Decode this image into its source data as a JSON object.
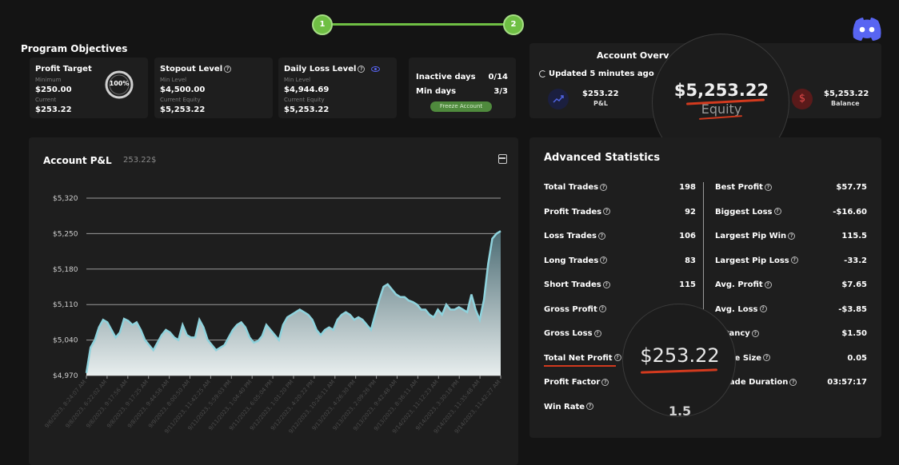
{
  "stepper": {
    "step1": "1",
    "step2": "2"
  },
  "objectives": {
    "title": "Program Objectives",
    "profit_target": {
      "label": "Profit Target",
      "min_label": "Minimum",
      "min_value": "$250.00",
      "cur_label": "Current",
      "cur_value": "$253.22",
      "ring_text": "100%",
      "progress_percent": 100
    },
    "stopout": {
      "label": "Stopout Level",
      "min_label": "Min Level",
      "min_value": "$4,500.00",
      "cur_label": "Current Equity",
      "cur_value": "$5,253.22"
    },
    "daily_loss": {
      "label": "Daily Loss Level",
      "min_label": "Min Level",
      "min_value": "$4,944.69",
      "cur_label": "Current Equity",
      "cur_value": "$5,253.22"
    },
    "days": {
      "inactive_label": "Inactive days",
      "inactive_value": "0/14",
      "min_label": "Min days",
      "min_value": "3/3",
      "freeze_label": "Freeze Account"
    }
  },
  "overview": {
    "title": "Account Overv",
    "updated": "Updated 5 minutes ago",
    "pnl_value": "$253.22",
    "pnl_label": "P&L",
    "equity_value": "$5,253.22",
    "equity_label": "Equity",
    "balance_value": "$5,253.22",
    "balance_label": "Balance",
    "balance_icon": "$"
  },
  "pnl_chart": {
    "title": "Account P&L",
    "amount": "253.22$",
    "icon": "calendar-icon"
  },
  "chart_data": {
    "type": "area",
    "yticks": [
      "$5,320",
      "$5,250",
      "$5,180",
      "$5,110",
      "$5,040",
      "$4,970"
    ],
    "ylim": [
      4970,
      5320
    ],
    "values": [
      4975,
      5025,
      5040,
      5065,
      5080,
      5075,
      5060,
      5045,
      5055,
      5082,
      5078,
      5070,
      5075,
      5060,
      5040,
      5030,
      5020,
      5035,
      5050,
      5060,
      5055,
      5045,
      5040,
      5070,
      5050,
      5045,
      5045,
      5080,
      5065,
      5040,
      5030,
      5020,
      5025,
      5030,
      5045,
      5060,
      5070,
      5075,
      5065,
      5045,
      5035,
      5038,
      5048,
      5070,
      5060,
      5050,
      5040,
      5070,
      5085,
      5090,
      5095,
      5100,
      5095,
      5090,
      5080,
      5060,
      5050,
      5060,
      5065,
      5060,
      5080,
      5090,
      5095,
      5090,
      5080,
      5085,
      5080,
      5070,
      5060,
      5090,
      5120,
      5145,
      5150,
      5140,
      5130,
      5125,
      5125,
      5118,
      5115,
      5110,
      5100,
      5100,
      5090,
      5085,
      5100,
      5090,
      5110,
      5100,
      5100,
      5105,
      5100,
      5095,
      5130,
      5100,
      5080,
      5120,
      5190,
      5240,
      5250,
      5255
    ],
    "xticks": [
      "9/6/2023, 8:24:07 AM",
      "9/8/2023, 6:22:02 AM",
      "9/8/2023, 9:17:56 AM",
      "9/8/2023, 9:17:25 AM",
      "9/8/2023, 9:44:58 AM",
      "9/9/2023, 8:00:50 AM",
      "9/11/2023, 11:42:25 AM",
      "9/11/2023, 5:59:03 PM",
      "9/11/2023, 1:04:40 PM",
      "9/11/2023, 6:05:04 PM",
      "9/12/2023, 1:01:20 PM",
      "9/12/2023, 4:20:22 PM",
      "9/12/2023, 10:26:11 AM",
      "9/13/2023, 4:26:30 PM",
      "9/13/2023, 2:09:26 PM",
      "9/13/2023, 9:42:48 AM",
      "9/13/2023, 8:36:11 AM",
      "9/14/2023, 11:12:23 AM",
      "9/14/2023, 3:30:18 PM",
      "9/14/2023, 11:35:48 AM",
      "9/14/2023, 11:42:27 AM"
    ]
  },
  "advanced": {
    "title": "Advanced Statistics",
    "left": [
      {
        "label": "Total Trades",
        "value": "198"
      },
      {
        "label": "Profit Trades",
        "value": "92"
      },
      {
        "label": "Loss Trades",
        "value": "106"
      },
      {
        "label": "Long Trades",
        "value": "83"
      },
      {
        "label": "Short Trades",
        "value": "115"
      },
      {
        "label": "Gross Profit",
        "value": ""
      },
      {
        "label": "Gross Loss",
        "value": ""
      },
      {
        "label": "Total Net Profit",
        "value": ""
      },
      {
        "label": "Profit Factor",
        "value": ""
      },
      {
        "label": "Win Rate",
        "value": ""
      }
    ],
    "right": [
      {
        "label": "Best Profit",
        "value": "$57.75"
      },
      {
        "label": "Biggest Loss",
        "value": "-$16.60"
      },
      {
        "label": "Largest Pip Win",
        "value": "115.5"
      },
      {
        "label": "Largest Pip Loss",
        "value": "-33.2"
      },
      {
        "label": "Avg. Profit",
        "value": "$7.65"
      },
      {
        "label": "Avg. Loss",
        "value": "-$3.85"
      },
      {
        "label": "ectancy",
        "value": "$1.50"
      },
      {
        "label": "Trade Size",
        "value": "0.05"
      },
      {
        "label": ". Trade Duration",
        "value": "03:57:17"
      }
    ],
    "zoom_value": "$253.22",
    "zoom_partial": "1.5"
  },
  "colors": {
    "accent_green": "#6fbf44",
    "chart_line": "#8fd3dd",
    "discord": "#5865f2",
    "underline": "#d23a1e"
  }
}
